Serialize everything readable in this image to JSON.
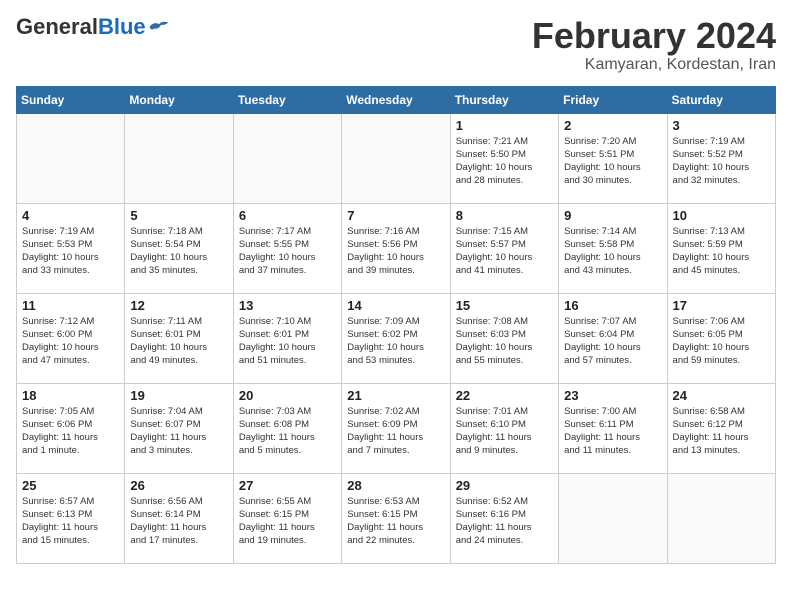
{
  "header": {
    "logo_general": "General",
    "logo_blue": "Blue",
    "month_title": "February 2024",
    "location": "Kamyaran, Kordestan, Iran"
  },
  "days_of_week": [
    "Sunday",
    "Monday",
    "Tuesday",
    "Wednesday",
    "Thursday",
    "Friday",
    "Saturday"
  ],
  "weeks": [
    [
      {
        "day": "",
        "info": ""
      },
      {
        "day": "",
        "info": ""
      },
      {
        "day": "",
        "info": ""
      },
      {
        "day": "",
        "info": ""
      },
      {
        "day": "1",
        "info": "Sunrise: 7:21 AM\nSunset: 5:50 PM\nDaylight: 10 hours\nand 28 minutes."
      },
      {
        "day": "2",
        "info": "Sunrise: 7:20 AM\nSunset: 5:51 PM\nDaylight: 10 hours\nand 30 minutes."
      },
      {
        "day": "3",
        "info": "Sunrise: 7:19 AM\nSunset: 5:52 PM\nDaylight: 10 hours\nand 32 minutes."
      }
    ],
    [
      {
        "day": "4",
        "info": "Sunrise: 7:19 AM\nSunset: 5:53 PM\nDaylight: 10 hours\nand 33 minutes."
      },
      {
        "day": "5",
        "info": "Sunrise: 7:18 AM\nSunset: 5:54 PM\nDaylight: 10 hours\nand 35 minutes."
      },
      {
        "day": "6",
        "info": "Sunrise: 7:17 AM\nSunset: 5:55 PM\nDaylight: 10 hours\nand 37 minutes."
      },
      {
        "day": "7",
        "info": "Sunrise: 7:16 AM\nSunset: 5:56 PM\nDaylight: 10 hours\nand 39 minutes."
      },
      {
        "day": "8",
        "info": "Sunrise: 7:15 AM\nSunset: 5:57 PM\nDaylight: 10 hours\nand 41 minutes."
      },
      {
        "day": "9",
        "info": "Sunrise: 7:14 AM\nSunset: 5:58 PM\nDaylight: 10 hours\nand 43 minutes."
      },
      {
        "day": "10",
        "info": "Sunrise: 7:13 AM\nSunset: 5:59 PM\nDaylight: 10 hours\nand 45 minutes."
      }
    ],
    [
      {
        "day": "11",
        "info": "Sunrise: 7:12 AM\nSunset: 6:00 PM\nDaylight: 10 hours\nand 47 minutes."
      },
      {
        "day": "12",
        "info": "Sunrise: 7:11 AM\nSunset: 6:01 PM\nDaylight: 10 hours\nand 49 minutes."
      },
      {
        "day": "13",
        "info": "Sunrise: 7:10 AM\nSunset: 6:01 PM\nDaylight: 10 hours\nand 51 minutes."
      },
      {
        "day": "14",
        "info": "Sunrise: 7:09 AM\nSunset: 6:02 PM\nDaylight: 10 hours\nand 53 minutes."
      },
      {
        "day": "15",
        "info": "Sunrise: 7:08 AM\nSunset: 6:03 PM\nDaylight: 10 hours\nand 55 minutes."
      },
      {
        "day": "16",
        "info": "Sunrise: 7:07 AM\nSunset: 6:04 PM\nDaylight: 10 hours\nand 57 minutes."
      },
      {
        "day": "17",
        "info": "Sunrise: 7:06 AM\nSunset: 6:05 PM\nDaylight: 10 hours\nand 59 minutes."
      }
    ],
    [
      {
        "day": "18",
        "info": "Sunrise: 7:05 AM\nSunset: 6:06 PM\nDaylight: 11 hours\nand 1 minute."
      },
      {
        "day": "19",
        "info": "Sunrise: 7:04 AM\nSunset: 6:07 PM\nDaylight: 11 hours\nand 3 minutes."
      },
      {
        "day": "20",
        "info": "Sunrise: 7:03 AM\nSunset: 6:08 PM\nDaylight: 11 hours\nand 5 minutes."
      },
      {
        "day": "21",
        "info": "Sunrise: 7:02 AM\nSunset: 6:09 PM\nDaylight: 11 hours\nand 7 minutes."
      },
      {
        "day": "22",
        "info": "Sunrise: 7:01 AM\nSunset: 6:10 PM\nDaylight: 11 hours\nand 9 minutes."
      },
      {
        "day": "23",
        "info": "Sunrise: 7:00 AM\nSunset: 6:11 PM\nDaylight: 11 hours\nand 11 minutes."
      },
      {
        "day": "24",
        "info": "Sunrise: 6:58 AM\nSunset: 6:12 PM\nDaylight: 11 hours\nand 13 minutes."
      }
    ],
    [
      {
        "day": "25",
        "info": "Sunrise: 6:57 AM\nSunset: 6:13 PM\nDaylight: 11 hours\nand 15 minutes."
      },
      {
        "day": "26",
        "info": "Sunrise: 6:56 AM\nSunset: 6:14 PM\nDaylight: 11 hours\nand 17 minutes."
      },
      {
        "day": "27",
        "info": "Sunrise: 6:55 AM\nSunset: 6:15 PM\nDaylight: 11 hours\nand 19 minutes."
      },
      {
        "day": "28",
        "info": "Sunrise: 6:53 AM\nSunset: 6:15 PM\nDaylight: 11 hours\nand 22 minutes."
      },
      {
        "day": "29",
        "info": "Sunrise: 6:52 AM\nSunset: 6:16 PM\nDaylight: 11 hours\nand 24 minutes."
      },
      {
        "day": "",
        "info": ""
      },
      {
        "day": "",
        "info": ""
      }
    ]
  ]
}
